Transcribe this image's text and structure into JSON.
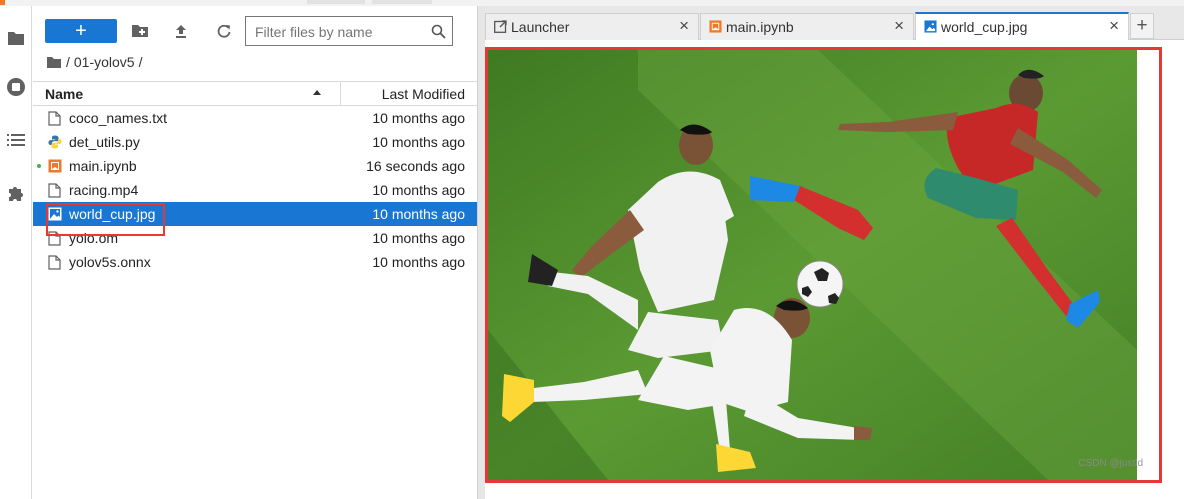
{
  "toolbar": {
    "new_button_label": "+",
    "filter_placeholder": "Filter files by name"
  },
  "breadcrumb": {
    "separator_start": "/",
    "folder": "01-yolov5",
    "separator_end": "/"
  },
  "file_list": {
    "header_name": "Name",
    "header_modified": "Last Modified",
    "files": [
      {
        "name": "coco_names.txt",
        "modified": "10 months ago",
        "icon": "text-file-icon",
        "running": false,
        "selected": false
      },
      {
        "name": "det_utils.py",
        "modified": "10 months ago",
        "icon": "python-file-icon",
        "running": false,
        "selected": false
      },
      {
        "name": "main.ipynb",
        "modified": "16 seconds ago",
        "icon": "notebook-icon",
        "running": true,
        "selected": false
      },
      {
        "name": "racing.mp4",
        "modified": "10 months ago",
        "icon": "file-icon",
        "running": false,
        "selected": false
      },
      {
        "name": "world_cup.jpg",
        "modified": "10 months ago",
        "icon": "image-file-icon",
        "running": false,
        "selected": true
      },
      {
        "name": "yolo.om",
        "modified": "10 months ago",
        "icon": "file-icon",
        "running": false,
        "selected": false
      },
      {
        "name": "yolov5s.onnx",
        "modified": "10 months ago",
        "icon": "file-icon",
        "running": false,
        "selected": false
      }
    ]
  },
  "tabs": [
    {
      "label": "Launcher",
      "icon": "launcher-icon",
      "active": false
    },
    {
      "label": "main.ipynb",
      "icon": "notebook-icon",
      "active": false
    },
    {
      "label": "world_cup.jpg",
      "icon": "image-file-icon",
      "active": true
    }
  ],
  "tab_close_glyph": "×",
  "tab_add_glyph": "+",
  "image_viewer": {
    "watermark": "CSDN @justld"
  },
  "colors": {
    "accent": "#1976d2",
    "highlight_box": "#e53935",
    "grass": "#4f8a2b",
    "notebook_orange": "#f37726"
  }
}
